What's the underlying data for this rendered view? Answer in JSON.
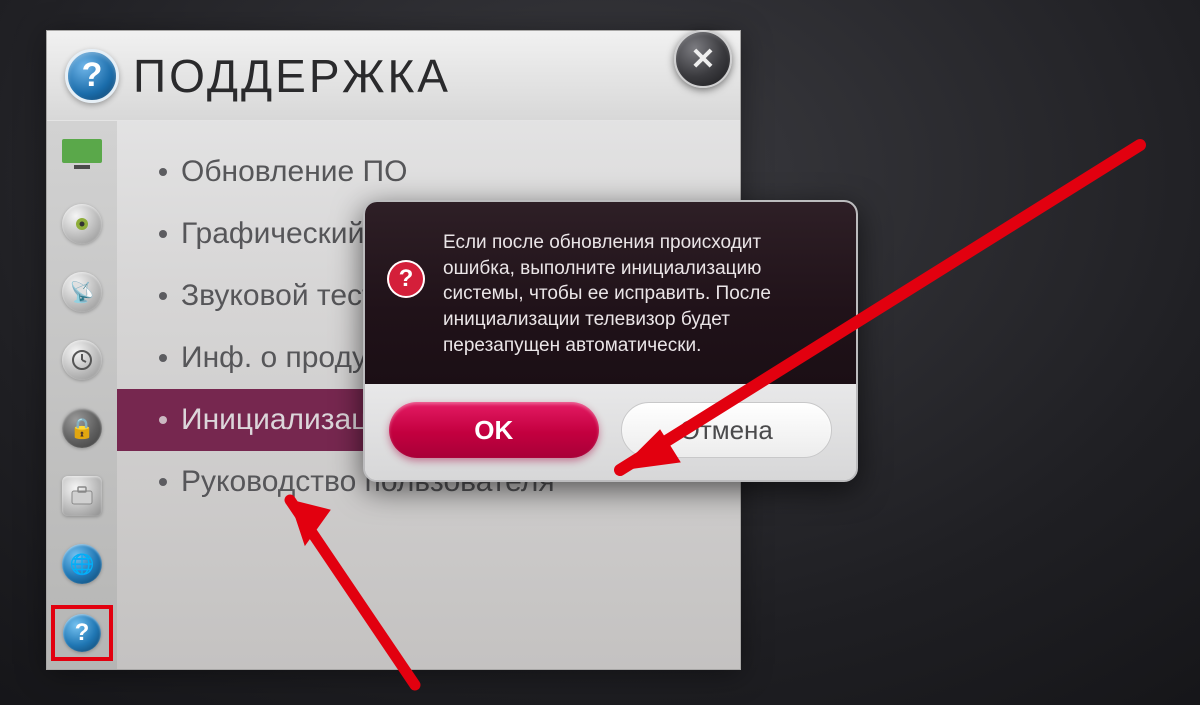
{
  "header": {
    "title": "ПОДДЕРЖКА"
  },
  "close_label": "✕",
  "menu": {
    "items": [
      {
        "label": "Обновление ПО"
      },
      {
        "label": "Графический тест"
      },
      {
        "label": "Звуковой тест"
      },
      {
        "label": "Инф. о продукте"
      },
      {
        "label": "Инициализация"
      },
      {
        "label": "Руководство пользователя"
      }
    ],
    "selected_index": 4
  },
  "dialog": {
    "message": "Если после обновления происходит ошибка, выполните инициализацию системы, чтобы ее исправить. После инициализации телевизор будет перезапущен автоматически.",
    "ok_label": "OK",
    "cancel_label": "Отмена"
  },
  "sidebar": {
    "items": [
      {
        "name": "picture-icon"
      },
      {
        "name": "sound-icon"
      },
      {
        "name": "channel-icon"
      },
      {
        "name": "time-icon"
      },
      {
        "name": "lock-icon"
      },
      {
        "name": "option-icon"
      },
      {
        "name": "network-icon"
      },
      {
        "name": "support-icon"
      }
    ],
    "active_index": 7
  }
}
